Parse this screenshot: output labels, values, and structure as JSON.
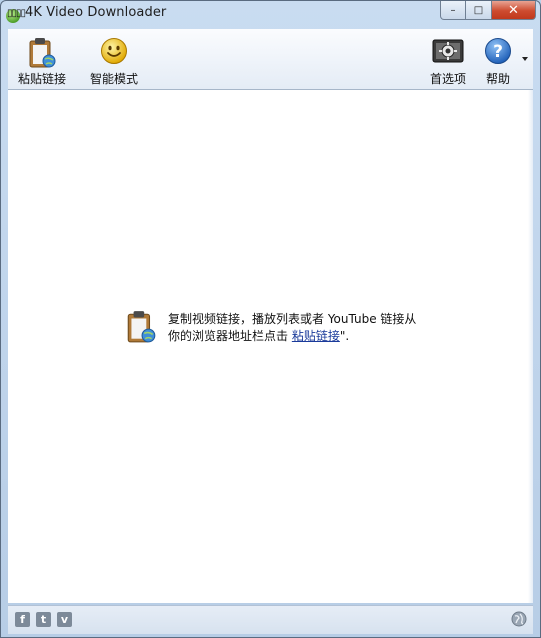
{
  "window": {
    "title": "4K Video Downloader",
    "title_glyphs": "▯▯▯▯",
    "minimize_label": "–",
    "maximize_label": "□",
    "close_label": "✕"
  },
  "toolbar": {
    "paste_link_label": "粘贴链接",
    "smart_mode_label": "智能模式",
    "preferences_label": "首选项",
    "help_label": "帮助"
  },
  "hint": {
    "line1": "复制视频链接，播放列表或者 YouTube 链接从",
    "line2_prefix": "你的浏览器地址栏点击 ",
    "link": "粘贴链接",
    "line2_suffix": "\"."
  },
  "statusbar": {
    "facebook": "f",
    "twitter": "t",
    "vimeo": "v"
  },
  "icons": {
    "paste": "clipboard-globe-icon",
    "smart": "smiley-icon",
    "prefs": "settings-icon",
    "help": "question-icon",
    "globe": "globe-icon"
  }
}
